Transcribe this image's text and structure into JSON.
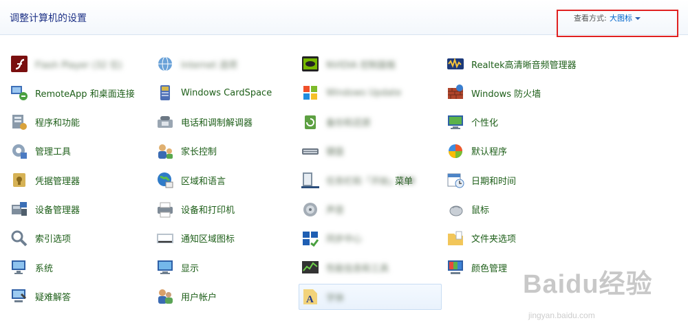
{
  "header": {
    "title": "调整计算机的设置",
    "view_by_label": "查看方式:",
    "view_by_value": "大图标"
  },
  "columns": [
    {
      "items": [
        {
          "label": "Flash Player (32 位)",
          "icon": "flash-player-icon",
          "blurred": true
        },
        {
          "label": "RemoteApp 和桌面连接",
          "icon": "remoteapp-icon"
        },
        {
          "label": "程序和功能",
          "icon": "programs-features-icon"
        },
        {
          "label": "管理工具",
          "icon": "admin-tools-icon"
        },
        {
          "label": "凭据管理器",
          "icon": "credential-manager-icon"
        },
        {
          "label": "设备管理器",
          "icon": "device-manager-icon"
        },
        {
          "label": "索引选项",
          "icon": "indexing-options-icon"
        },
        {
          "label": "系统",
          "icon": "system-icon"
        },
        {
          "label": "疑难解答",
          "icon": "troubleshooting-icon"
        }
      ]
    },
    {
      "items": [
        {
          "label": "Internet 选项",
          "icon": "internet-options-icon",
          "blurred": true
        },
        {
          "label": "Windows CardSpace",
          "icon": "cardspace-icon"
        },
        {
          "label": "电话和调制解调器",
          "icon": "phone-modem-icon"
        },
        {
          "label": "家长控制",
          "icon": "parental-controls-icon"
        },
        {
          "label": "区域和语言",
          "icon": "region-language-icon"
        },
        {
          "label": "设备和打印机",
          "icon": "devices-printers-icon"
        },
        {
          "label": "通知区域图标",
          "icon": "notification-area-icon"
        },
        {
          "label": "显示",
          "icon": "display-icon"
        },
        {
          "label": "用户帐户",
          "icon": "user-accounts-icon"
        }
      ]
    },
    {
      "items": [
        {
          "label": "NVIDIA 控制面板",
          "icon": "nvidia-icon",
          "blurred": true
        },
        {
          "label": "Windows Update",
          "icon": "windows-update-icon",
          "blurred": true
        },
        {
          "label": "备份和还原",
          "icon": "backup-restore-icon",
          "blurred": true
        },
        {
          "label": "键盘",
          "icon": "keyboard-icon",
          "blurred": true
        },
        {
          "label": "任务栏和「开始」菜单",
          "icon": "taskbar-start-menu-icon",
          "blurred": true,
          "visible_suffix": "菜单"
        },
        {
          "label": "声音",
          "icon": "sound-icon",
          "blurred": true
        },
        {
          "label": "同步中心",
          "icon": "sync-center-icon",
          "blurred": true
        },
        {
          "label": "性能信息和工具",
          "icon": "performance-icon",
          "blurred": true
        },
        {
          "label": "字体",
          "icon": "fonts-icon",
          "blurred": true,
          "selected": true
        }
      ]
    },
    {
      "items": [
        {
          "label": "Realtek高清晰音频管理器",
          "icon": "realtek-audio-icon"
        },
        {
          "label": "Windows 防火墙",
          "icon": "firewall-icon"
        },
        {
          "label": "个性化",
          "icon": "personalization-icon"
        },
        {
          "label": "默认程序",
          "icon": "default-programs-icon"
        },
        {
          "label": "日期和时间",
          "icon": "date-time-icon"
        },
        {
          "label": "鼠标",
          "icon": "mouse-icon"
        },
        {
          "label": "文件夹选项",
          "icon": "folder-options-icon"
        },
        {
          "label": "颜色管理",
          "icon": "color-management-icon"
        }
      ]
    }
  ],
  "watermark": {
    "brand": "Baidu经验",
    "url": "jingyan.baidu.com"
  }
}
